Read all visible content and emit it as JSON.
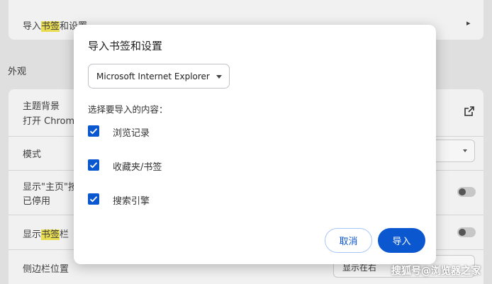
{
  "background": {
    "import_row": {
      "before": "导入",
      "highlight": "书签",
      "after": "和设置"
    },
    "section_heading": "外观",
    "theme": {
      "title": "主题背景",
      "subtitle": "打开 Chrome"
    },
    "mode": {
      "label": "模式"
    },
    "home_button": {
      "title": "显示\"主页\"按",
      "subtitle": "已停用"
    },
    "bookmarks_bar": {
      "before": "显示",
      "highlight": "书签",
      "after": "栏"
    },
    "side_panel": {
      "label": "侧边栏位置",
      "value": "显示在右"
    }
  },
  "dialog": {
    "title": "导入书签和设置",
    "browser_select": {
      "value": "Microsoft Internet Explorer"
    },
    "prompt": "选择要导入的内容：",
    "options": [
      {
        "label": "浏览记录",
        "checked": true
      },
      {
        "label": "收藏夹/书签",
        "checked": true
      },
      {
        "label": "搜索引擎",
        "checked": true
      }
    ],
    "cancel_label": "取消",
    "import_label": "导入"
  },
  "watermark": "搜狐号@浏览器之家",
  "colors": {
    "primary": "#0b57d0",
    "highlight": "#e8dc52"
  }
}
